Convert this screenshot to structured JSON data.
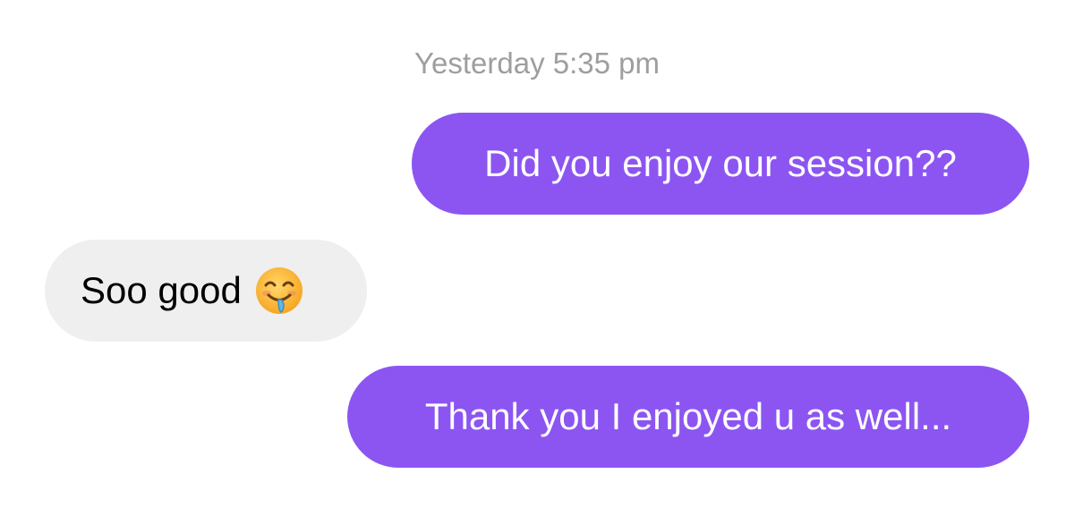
{
  "conversation": {
    "timestamp": "Yesterday 5:35 pm",
    "messages": [
      {
        "direction": "sent",
        "text": "Did you enjoy our session??"
      },
      {
        "direction": "received",
        "text": "Soo good",
        "emoji": "face-savoring-food-icon"
      },
      {
        "direction": "sent",
        "text": "Thank you I enjoyed u as well..."
      }
    ]
  },
  "colors": {
    "sent_bubble": "#8c55f2",
    "received_bubble": "#efefef",
    "timestamp_text": "#9e9e9e"
  }
}
